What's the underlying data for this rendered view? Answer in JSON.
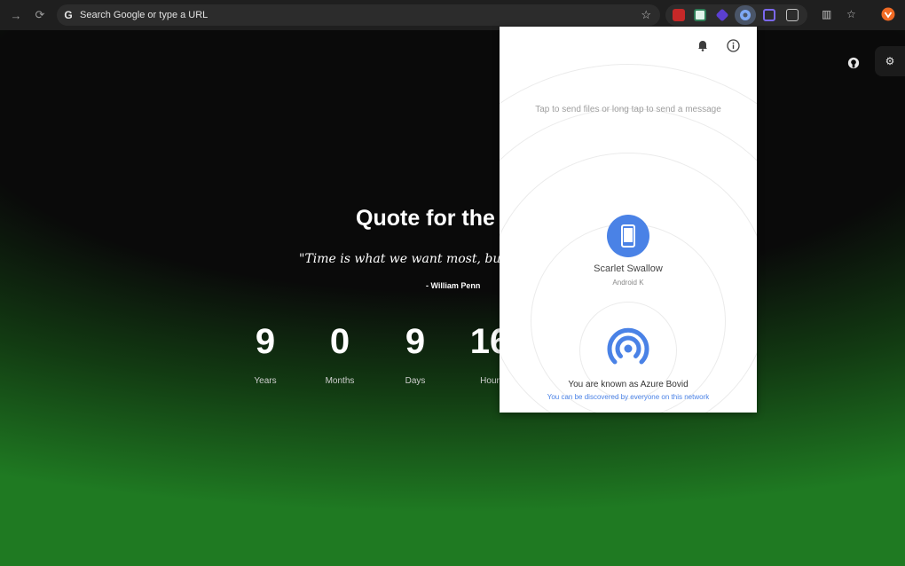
{
  "browser": {
    "omnibox_placeholder": "Search Google or type a URL",
    "google_logo": "G",
    "icons": [
      "forward-icon",
      "reload-icon",
      "bookmark-star-icon",
      "puzzle-icon",
      "side-panel-icon",
      "bookmarks-icon",
      "brave-icon"
    ]
  },
  "page": {
    "quote_title": "Quote for the",
    "quote_text": "\"Time is what we want most, but w",
    "quote_author": "- William Penn",
    "countdown": [
      {
        "value": "9",
        "label": "Years"
      },
      {
        "value": "0",
        "label": "Months"
      },
      {
        "value": "9",
        "label": "Days"
      },
      {
        "value": "16",
        "label": "Hour"
      }
    ]
  },
  "popup": {
    "hint": "Tap to send files or long tap to send a message",
    "device": {
      "name": "Scarlet Swallow",
      "type": "Android K"
    },
    "self_name": "You are known as Azure Bovid",
    "discoverable": "You can be discovered by everyone on this network"
  },
  "colors": {
    "accent": "#4a82e6",
    "green": "#1f7a22"
  }
}
